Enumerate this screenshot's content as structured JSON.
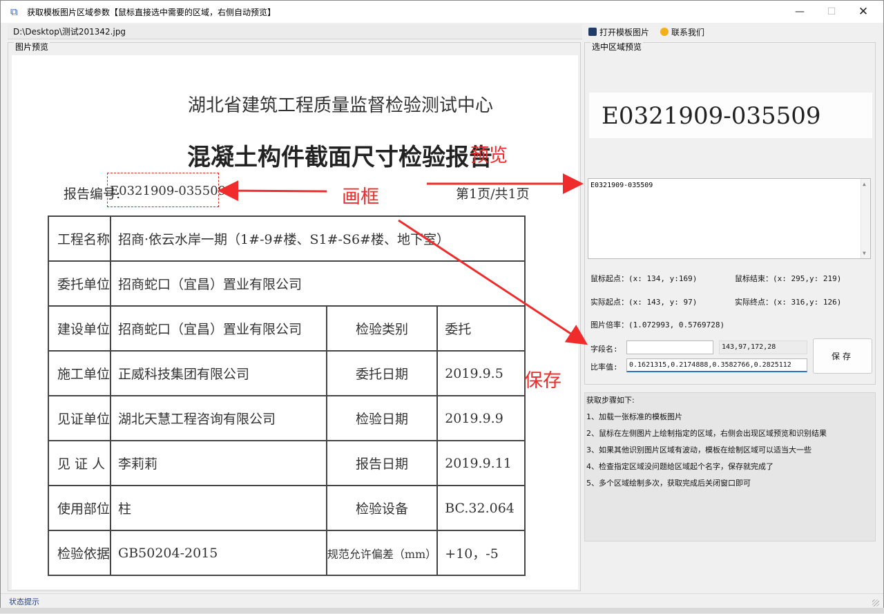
{
  "window": {
    "title": "获取模板图片区域参数【鼠标直接选中需要的区域，右侧自动预览】",
    "minimize": "—",
    "maximize": "☐",
    "close": "✕"
  },
  "path": "D:\\Desktop\\测试201342.jpg",
  "toolbar": {
    "open_label": "打开模板图片",
    "contact_label": "联系我们"
  },
  "left_group": {
    "label": "图片预览"
  },
  "document": {
    "org": "湖北省建筑工程质量监督检验测试中心",
    "title": "混凝土构件截面尺寸检验报告",
    "report_no_label": "报告编号:",
    "report_no": "E0321909-035509",
    "page": "第1页/共1页",
    "rows": [
      {
        "label": "工程名称",
        "value": "招商·依云水岸一期（1#-9#楼、S1#-S6#楼、地下室）"
      },
      {
        "label": "委托单位",
        "value": "招商蛇口（宜昌）置业有限公司"
      },
      {
        "label": "建设单位",
        "value": "招商蛇口（宜昌）置业有限公司",
        "label2": "检验类别",
        "value2": "委托"
      },
      {
        "label": "施工单位",
        "value": "正威科技集团有限公司",
        "label2": "委托日期",
        "value2": "2019.9.5"
      },
      {
        "label": "见证单位",
        "value": "湖北天慧工程咨询有限公司",
        "label2": "检验日期",
        "value2": "2019.9.9"
      },
      {
        "label": "见 证 人",
        "value": "李莉莉",
        "label2": "报告日期",
        "value2": "2019.9.11"
      },
      {
        "label": "使用部位",
        "value": "柱",
        "label2": "检验设备",
        "value2": "BC.32.064"
      },
      {
        "label": "检验依据",
        "value": "GB50204-2015",
        "label2": "规范允许偏差（mm）",
        "value2": "+10，-5"
      }
    ]
  },
  "annotations": {
    "preview": "预览",
    "frame": "画框",
    "save": "保存"
  },
  "right_group": {
    "label": "选中区域预览",
    "preview_text": "E0321909-035509",
    "result_text": "E0321909-035509",
    "mouse_start": "鼠标起点：(x: 134, y:169)",
    "mouse_end": "鼠标结束：(x: 295,y: 219)",
    "actual_start": "实际起点：(x: 143, y: 97)",
    "actual_end": "实际终点：(x: 316,y: 126)",
    "scale": "图片倍率：(1.072993, 0.5769728)",
    "field_name_label": "字段名:",
    "field_name_value": "",
    "coords_value": "143,97,172,28",
    "ratio_label": "比率值:",
    "ratio_value": "0.1621315,0.2174888,0.3582766,0.2825112",
    "save_button": "保存"
  },
  "steps": {
    "title": "获取步骤如下:",
    "items": [
      "1、加载一张标准的模板图片",
      "2、鼠标在左侧图片上绘制指定的区域，右侧会出现区域预览和识别结果",
      "3、如果其他识别图片区域有波动，模板在绘制区域可以适当大一些",
      "4、检查指定区域没问题给区域起个名字，保存就完成了",
      "5、多个区域绘制多次，获取完成后关闭窗口即可"
    ]
  },
  "status": "状态提示"
}
